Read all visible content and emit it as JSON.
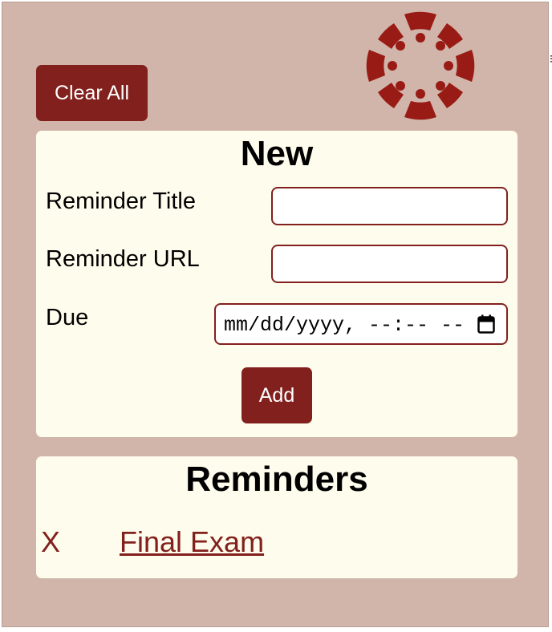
{
  "header": {
    "clear_all_label": "Clear All",
    "logo_icon": "canvas-logo-icon",
    "brand_color": "#82201d"
  },
  "new_section": {
    "title": "New",
    "title_label": "Reminder Title",
    "title_value": "",
    "url_label": "Reminder URL",
    "url_value": "",
    "due_label": "Due",
    "due_placeholder": "mm/dd/yyyy, --:-- --",
    "calendar_icon": "calendar-icon",
    "add_label": "Add"
  },
  "reminders_section": {
    "title": "Reminders",
    "items": [
      {
        "remove_label": "X",
        "title": "Final Exam"
      }
    ]
  }
}
